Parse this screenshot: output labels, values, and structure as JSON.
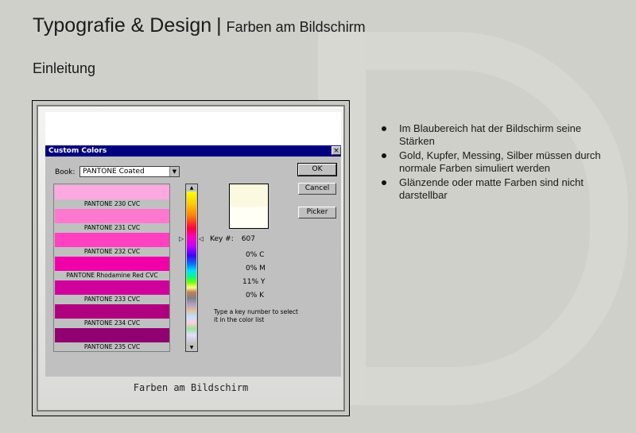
{
  "header": {
    "title": "Typografie & Design",
    "separator": "|",
    "subtitle": "Farben am Bildschirm"
  },
  "section": {
    "title": "Einleitung"
  },
  "figure": {
    "caption": "Farben am Bildschirm",
    "dialog": {
      "title": "Custom Colors",
      "close_label": "×",
      "book_label": "Book:",
      "book_value": "PANTONE Coated",
      "colors": [
        {
          "name": "PANTONE 230 CVC",
          "color": "#fda8e0"
        },
        {
          "name": "PANTONE 231 CVC",
          "color": "#ff78d0"
        },
        {
          "name": "PANTONE 232 CVC",
          "color": "#ff40c0"
        },
        {
          "name": "PANTONE Rhodamine Red CVC",
          "color": "#f000a8"
        },
        {
          "name": "PANTONE 233 CVC",
          "color": "#d0009c"
        },
        {
          "name": "PANTONE 234 CVC",
          "color": "#b00080"
        },
        {
          "name": "PANTONE 235 CVC",
          "color": "#900070"
        }
      ],
      "key_label": "Key #:",
      "key_value": "607",
      "cmyk": [
        {
          "value": "0%",
          "channel": "C"
        },
        {
          "value": "0%",
          "channel": "M"
        },
        {
          "value": "11%",
          "channel": "Y"
        },
        {
          "value": "0%",
          "channel": "K"
        }
      ],
      "help_text": "Type a key number to select it in the color list",
      "buttons": {
        "ok": "OK",
        "cancel": "Cancel",
        "picker": "Picker"
      }
    }
  },
  "bullets": [
    "Im Blaubereich hat der Bildschirm seine Stärken",
    "Gold, Kupfer, Messing, Silber müssen durch normale Farben simuliert werden",
    "Glänzende oder matte Farben sind nicht darstellbar"
  ]
}
